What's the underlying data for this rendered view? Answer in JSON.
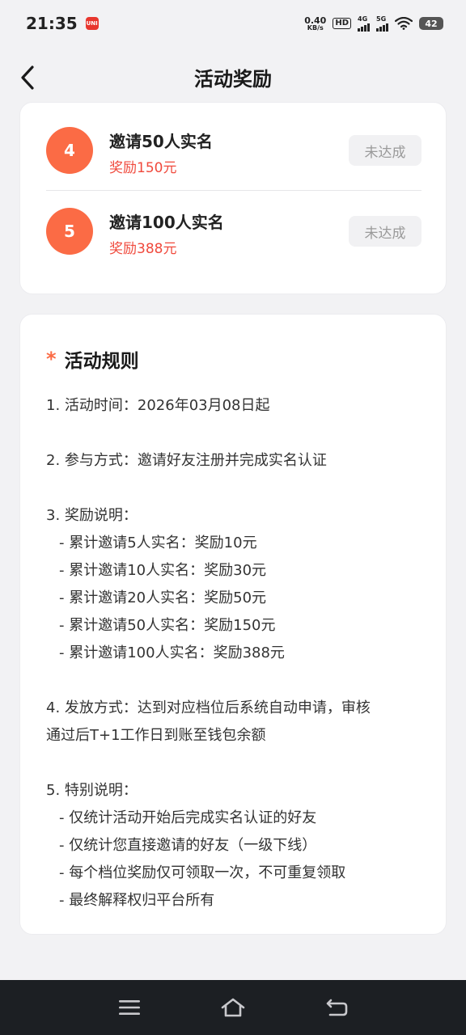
{
  "status_bar": {
    "time": "21:35",
    "app_badge": "UNI",
    "net_speed_value": "0.40",
    "net_speed_unit": "KB/s",
    "hd_label": "HD",
    "signal_1_label": "4G",
    "signal_2_label": "5G",
    "battery": "42"
  },
  "nav": {
    "title": "活动奖励"
  },
  "rewards": [
    {
      "number": "4",
      "title": "邀请50人实名",
      "amount": "奖励150元",
      "status": "未达成"
    },
    {
      "number": "5",
      "title": "邀请100人实名",
      "amount": "奖励388元",
      "status": "未达成"
    }
  ],
  "rules": {
    "star": "*",
    "title": "活动规则",
    "item1": "1. 活动时间：2026年03月08日起",
    "item2": "2. 参与方式：邀请好友注册并完成实名认证",
    "item3": "3. 奖励说明：",
    "item3_subs": [
      "- 累计邀请5人实名：奖励10元",
      "- 累计邀请10人实名：奖励30元",
      "- 累计邀请20人实名：奖励50元",
      "- 累计邀请50人实名：奖励150元",
      "- 累计邀请100人实名：奖励388元"
    ],
    "item4_line1": "4. 发放方式：达到对应档位后系统自动申请，审核",
    "item4_line2": "通过后T+1工作日到账至钱包余额",
    "item5": "5. 特别说明：",
    "item5_subs": [
      "- 仅统计活动开始后完成实名认证的好友",
      "- 仅统计您直接邀请的好友（一级下线）",
      "- 每个档位奖励仅可领取一次，不可重复领取",
      "- 最终解释权归平台所有"
    ]
  },
  "icons": {
    "back": "chevron-left-icon",
    "menu": "menu-icon",
    "home": "home-icon",
    "return": "return-icon"
  }
}
